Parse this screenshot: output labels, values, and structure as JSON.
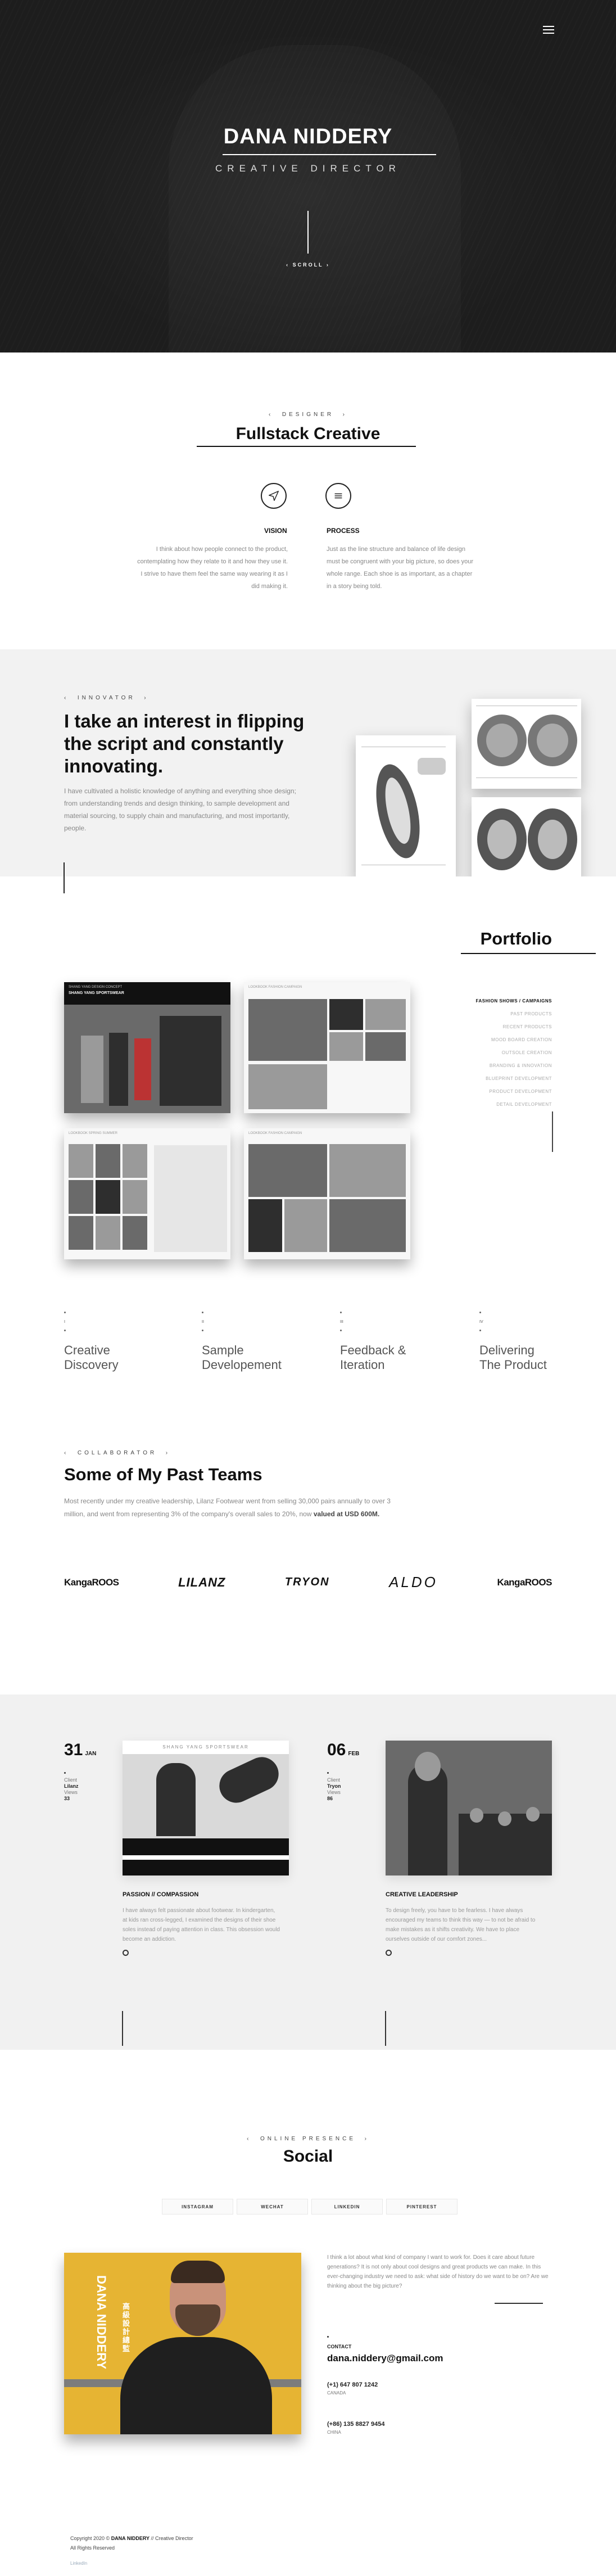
{
  "hero": {
    "name": "DANA NIDDERY",
    "role": "CREATIVE DIRECTOR",
    "scroll": "SCROLL"
  },
  "designer": {
    "eyebrow": "DESIGNER",
    "title": "Fullstack Creative",
    "vision_label": "VISION",
    "vision_text": "I think about how people connect to the product, contemplating how they relate to it and how they use it. I strive to have them feel the same way wearing it as I did making it.",
    "process_label": "PROCESS",
    "process_text": "Just as the line structure and balance of life design must be congruent with your big picture, so does your whole range. Each shoe is as important, as a chapter in a story being told."
  },
  "innovator": {
    "eyebrow": "INNOVATOR",
    "title": "I take an interest in flipping the script and constantly innovating.",
    "text": "I have cultivated a holistic knowledge of anything and everything shoe design; from understanding trends and design thinking, to sample development and material sourcing, to supply chain and manufacturing, and most importantly, people."
  },
  "portfolio": {
    "title": "Portfolio",
    "card_captions": [
      "SHANG YANG DESIGN CONCEPT",
      "LOOKBOOK FASHION CAMPAIGN",
      "LOOKBOOK SPRING SUMMER",
      "LOOKBOOK FASHION CAMPAIGN"
    ],
    "card_headline": "SHANG YANG SPORTSWEAR",
    "nav": [
      {
        "label": "FASHION SHOWS / CAMPAIGNS",
        "active": true
      },
      {
        "label": "PAST PRODUCTS",
        "active": false
      },
      {
        "label": "RECENT PRODUCTS",
        "active": false
      },
      {
        "label": "MOOD BOARD CREATION",
        "active": false
      },
      {
        "label": "OUTSOLE CREATION",
        "active": false
      },
      {
        "label": "BRANDING & INNOVATION",
        "active": false
      },
      {
        "label": "BLUEPRINT DEVELOPMENT",
        "active": false
      },
      {
        "label": "PRODUCT DEVELOPMENT",
        "active": false
      },
      {
        "label": "DETAIL DEVELOPMENT",
        "active": false
      }
    ],
    "steps": [
      {
        "num": "I",
        "label": "Creative Discovery"
      },
      {
        "num": "II",
        "label": "Sample Developement"
      },
      {
        "num": "III",
        "label": "Feedback & Iteration"
      },
      {
        "num": "IV",
        "label": "Delivering The Product"
      }
    ]
  },
  "teams": {
    "eyebrow": "COLLABORATOR",
    "title": "Some of My Past Teams",
    "text": "Most recently under my creative leadership, Lilanz Footwear went from selling 30,000 pairs annually to over 3 million, and went from representing 3% of the company's overall sales to 20%, now",
    "text_bold": "valued at USD 600M.",
    "logos": [
      "KangaROOS",
      "LILANZ",
      "TRYON",
      "ALDO",
      "KangaROOS"
    ]
  },
  "blog": {
    "posts": [
      {
        "day": "31",
        "month": "JAN",
        "client_label": "Client",
        "client": "Lilanz",
        "views_label": "Views",
        "views": "33",
        "header": "SHANG YANG SPORTSWEAR",
        "title": "PASSION // COMPASSION",
        "text": "I have always felt passionate about footwear. In kindergarten, at kids ran cross-legged, I examined the designs of their shoe soles instead of paying attention in class. This obsession would become an addiction."
      },
      {
        "day": "06",
        "month": "FEB",
        "client_label": "Client",
        "client": "Tryon",
        "views_label": "Views",
        "views": "86",
        "header": "",
        "title": "CREATIVE LEADERSHIP",
        "text": "To design freely, you have to be fearless. I have always encouraged my teams to think this way — to not be afraid to make mistakes as it shifts creativity. We have to place ourselves outside of our comfort zones..."
      }
    ]
  },
  "social": {
    "eyebrow": "ONLINE PRESENCE",
    "title": "Social",
    "buttons": [
      "INSTAGRAM",
      "WECHAT",
      "LINKEDIN",
      "PINTEREST"
    ],
    "portrait_name": "DANA NIDDERY",
    "portrait_cn": "高級設計總監",
    "intro": "I think a lot about what kind of company I want to work for. Does it care about future generations? It is not only about cool designs and great products we can make. In this ever-changing industry we need to ask: what side of history do we want to be on? Are we thinking about the big picture?",
    "contact_label": "CONTACT",
    "email": "dana.niddery@gmail.com",
    "phone1": "(+1) 647 807 1242",
    "country1": "CANADA",
    "phone2": "(+86) 135 8827 9454",
    "country2": "CHINA"
  },
  "footer": {
    "copy_prefix": "Copyright 2020 ©",
    "copy_name": "DANA NIDDERY",
    "copy_suffix": "// Creative Director",
    "rights": "All Rights Reserved",
    "link": "LinkedIn"
  }
}
